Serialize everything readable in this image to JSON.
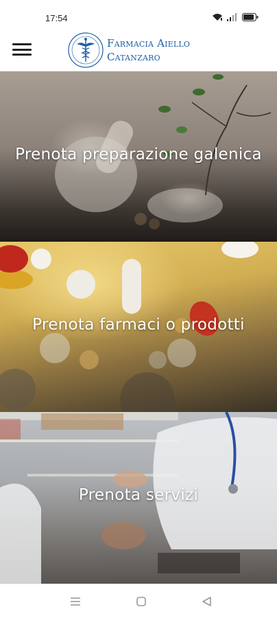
{
  "status_bar": {
    "time": "17:54",
    "icons": [
      "wifi-icon",
      "signal-icon",
      "battery-icon"
    ]
  },
  "header": {
    "menu_icon": "hamburger-menu-icon",
    "brand_line1": "Farmacia Aiello",
    "brand_line2": "Catanzaro",
    "logo_icon": "caduceus-logo-icon",
    "brand_color": "#1d5fa5"
  },
  "cards": [
    {
      "title": "Prenota preparazione galenica",
      "image": "mortar-and-plant-image"
    },
    {
      "title": "Prenota farmaci o prodotti",
      "image": "pills-image"
    },
    {
      "title": "Prenota servizi",
      "image": "doctor-consultation-image"
    }
  ],
  "nav_bar": {
    "icons": [
      "recent-apps-icon",
      "home-icon",
      "back-icon"
    ]
  }
}
